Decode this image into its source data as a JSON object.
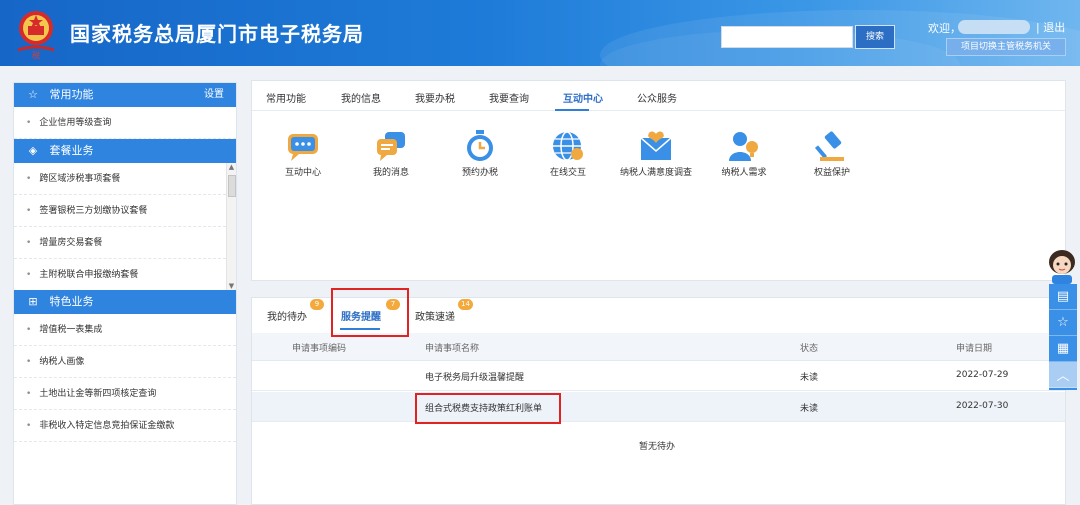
{
  "header": {
    "title": "国家税务总局厦门市电子税务局",
    "search_button": "搜索",
    "search_placeholder": "",
    "welcome": "欢迎，",
    "logout": "| 退出",
    "switch_agency": "项目切换主管税务机关"
  },
  "sidebar": {
    "common": {
      "title": "常用功能",
      "setting": "设置",
      "items": [
        "企业信用等级查询"
      ]
    },
    "package": {
      "title": "套餐业务",
      "items": [
        "跨区域涉税事项套餐",
        "签署银税三方划缴协议套餐",
        "增量房交易套餐",
        "主附税联合申报缴纳套餐"
      ]
    },
    "special": {
      "title": "特色业务",
      "items": [
        "增值税一表集成",
        "纳税人画像",
        "土地出让金等新四项核定查询",
        "非税收入特定信息竞拍保证金缴款"
      ]
    }
  },
  "main_tabs": [
    "常用功能",
    "我的信息",
    "我要办税",
    "我要查询",
    "互动中心",
    "公众服务"
  ],
  "active_main_tab": "互动中心",
  "functions": [
    {
      "label": "互动中心",
      "icon": "chat-bubble-icon"
    },
    {
      "label": "我的消息",
      "icon": "message-icon"
    },
    {
      "label": "预约办税",
      "icon": "stopwatch-icon"
    },
    {
      "label": "在线交互",
      "icon": "globe-icon"
    },
    {
      "label": "纳税人满意度调查",
      "icon": "envelope-heart-icon"
    },
    {
      "label": "纳税人需求",
      "icon": "user-bulb-icon"
    },
    {
      "label": "权益保护",
      "icon": "gavel-icon"
    }
  ],
  "sub_tabs": [
    {
      "label": "我的待办",
      "badge": "9"
    },
    {
      "label": "服务提醒",
      "badge": "7"
    },
    {
      "label": "政策速递",
      "badge": "14"
    }
  ],
  "active_sub_tab": "服务提醒",
  "table": {
    "headers": [
      "申请事项编码",
      "申请事项名称",
      "状态",
      "申请日期"
    ],
    "rows": [
      {
        "code": "",
        "name": "电子税务局升级温馨提醒",
        "status": "未读",
        "date": "2022-07-29"
      },
      {
        "code": "",
        "name": "组合式税费支持政策红利账单",
        "status": "未读",
        "date": "2022-07-30"
      }
    ],
    "empty_text": "暂无待办"
  },
  "colors": {
    "primary": "#2f84df",
    "header": "#1e7bd8",
    "badge": "#f4a93c",
    "highlight": "#e02424"
  }
}
